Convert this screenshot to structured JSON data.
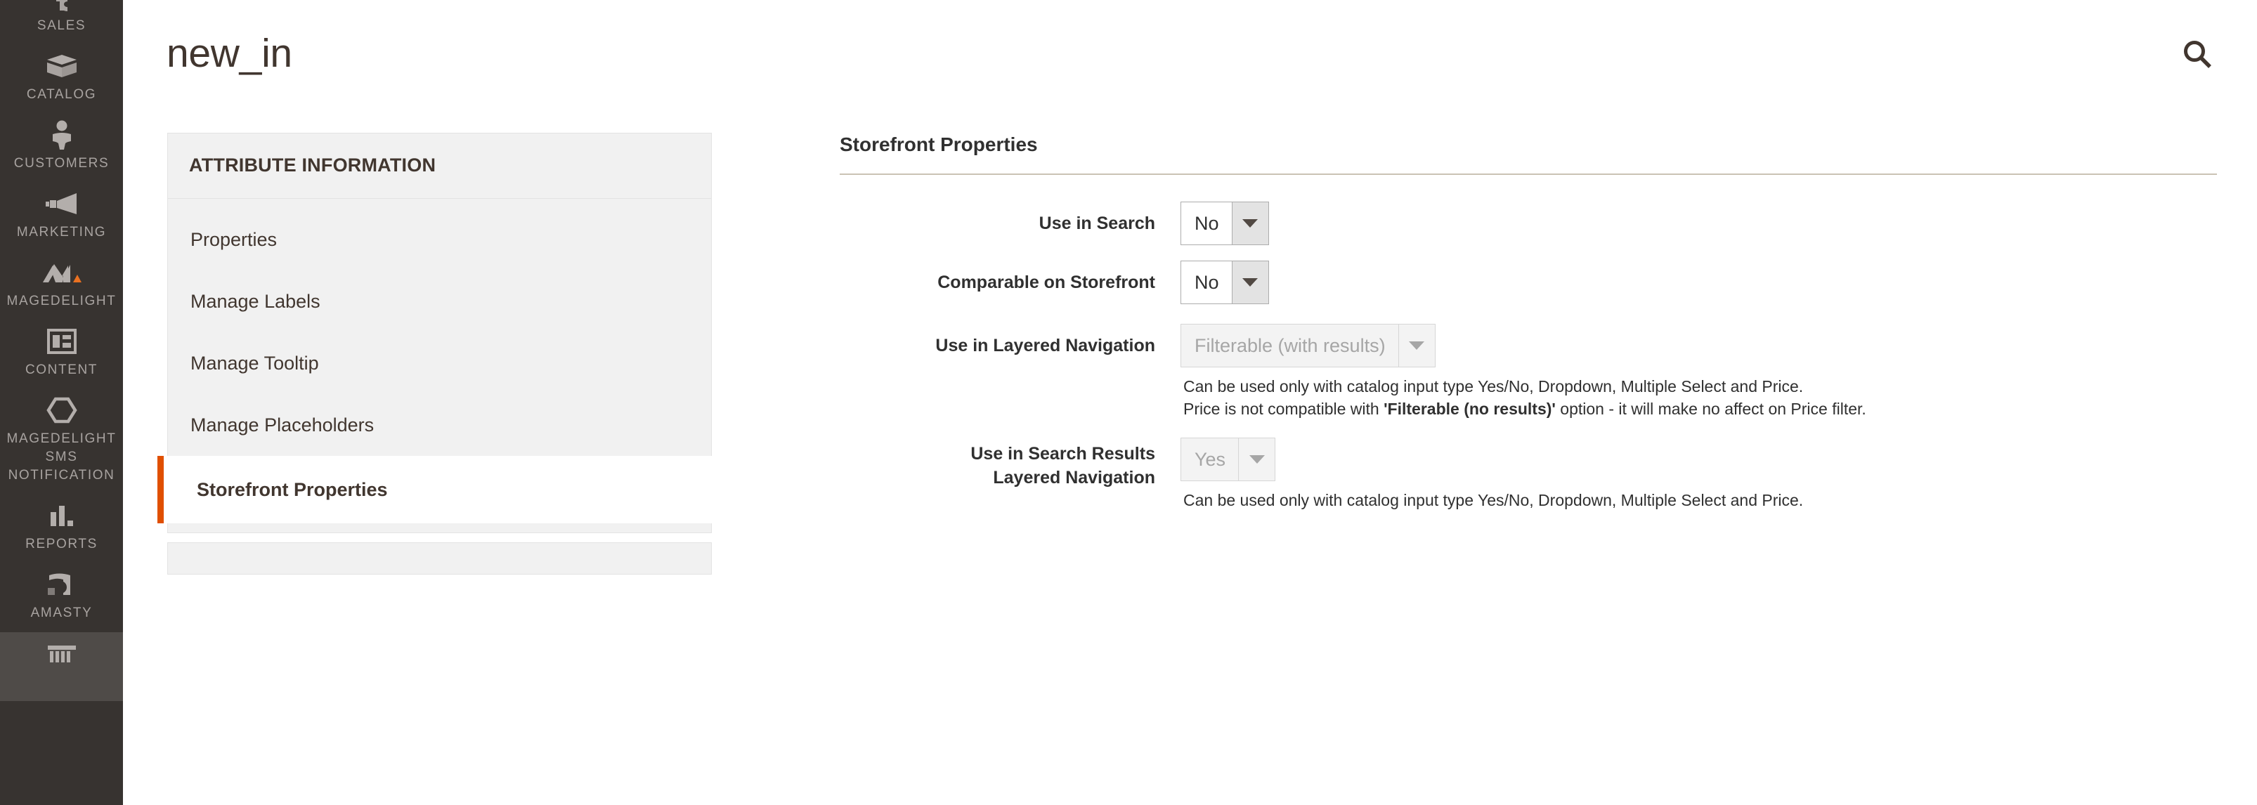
{
  "header": {
    "title": "new_in",
    "search_icon": "search-icon"
  },
  "admin_nav": {
    "items": [
      {
        "label": "SALES",
        "icon": "dollar-tag-icon",
        "hovered": false,
        "clipped_top": true
      },
      {
        "label": "CATALOG",
        "icon": "box-icon",
        "hovered": false
      },
      {
        "label": "CUSTOMERS",
        "icon": "person-icon",
        "hovered": false
      },
      {
        "label": "MARKETING",
        "icon": "megaphone-icon",
        "hovered": false
      },
      {
        "label": "MAGEDELIGHT",
        "icon": "magedelight-logo-icon",
        "hovered": false
      },
      {
        "label": "CONTENT",
        "icon": "layout-page-icon",
        "hovered": false
      },
      {
        "label": "MAGEDELIGHT SMS NOTIFICATION",
        "icon": "hexagon-icon",
        "hovered": false
      },
      {
        "label": "REPORTS",
        "icon": "bar-chart-icon",
        "hovered": false
      },
      {
        "label": "AMASTY",
        "icon": "amasty-a-icon",
        "hovered": false
      },
      {
        "label": "",
        "icon": "stores-icon",
        "hovered": true,
        "clipped_bottom": true
      }
    ]
  },
  "attribute_panel": {
    "title": "ATTRIBUTE INFORMATION",
    "items": [
      {
        "label": "Properties",
        "active": false
      },
      {
        "label": "Manage Labels",
        "active": false
      },
      {
        "label": "Manage Tooltip",
        "active": false
      },
      {
        "label": "Manage Placeholders",
        "active": false
      },
      {
        "label": "Storefront Properties",
        "active": true
      }
    ]
  },
  "storefront_properties": {
    "section_title": "Storefront Properties",
    "fields": [
      {
        "label": "Use in Search",
        "value": "No",
        "disabled": false,
        "notes": []
      },
      {
        "label": "Comparable on Storefront",
        "value": "No",
        "disabled": false,
        "notes": []
      },
      {
        "label": "Use in Layered Navigation",
        "value": "Filterable (with results)",
        "disabled": true,
        "notes": [
          {
            "text": "Can be used only with catalog input type Yes/No, Dropdown, Multiple Select and Price.",
            "bold_part": ""
          },
          {
            "prefix": "Price is not compatible with ",
            "bold_part": "'Filterable (no results)'",
            "suffix": " option - it will make no affect on Price filter."
          }
        ]
      },
      {
        "label": "Use in Search Results Layered Navigation",
        "label_line1": "Use in Search Results",
        "label_line2": "Layered Navigation",
        "value": "Yes",
        "disabled": true,
        "notes": [
          {
            "text": "Can be used only with catalog input type Yes/No, Dropdown, Multiple Select and Price.",
            "bold_part": ""
          }
        ]
      }
    ]
  },
  "colors": {
    "nav_background": "#373330",
    "nav_hover": "#4f4b48",
    "nav_label": "#a8a3a0",
    "accent_orange": "#e04f00",
    "panel_background": "#f1f1f1",
    "text_primary": "#303030",
    "title_text": "#41362f",
    "rule_tan": "#cac3b4",
    "disabled_text": "#a6a6a6"
  }
}
